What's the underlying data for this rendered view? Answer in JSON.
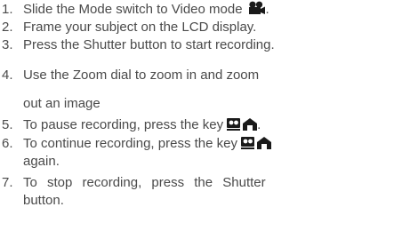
{
  "steps": [
    {
      "num": "1.",
      "text": "Slide the Mode switch to Video mode",
      "icon": "video-camera-icon",
      "suffix": "."
    },
    {
      "num": "2.",
      "text": "Frame your subject on the LCD display."
    },
    {
      "num": "3.",
      "text": "Press the Shutter button to start recording."
    },
    {
      "num": "4.",
      "text": "Use the Zoom dial to zoom in and zoom",
      "cont": "out an image"
    },
    {
      "num": "5.",
      "text": "To pause recording, press the key",
      "icon": "pause-key-icon",
      "suffix": "."
    },
    {
      "num": "6.",
      "text": "To continue recording, press the key",
      "icon": "pause-key-icon",
      "cont": "again."
    },
    {
      "num": "7.",
      "text": "To stop recording, press the Shutter",
      "cont": "button."
    }
  ],
  "icons": {
    "video": "video-camera-icon",
    "pause_key": "pause-key-icon"
  },
  "colors": {
    "text": "#4a4a4a"
  }
}
